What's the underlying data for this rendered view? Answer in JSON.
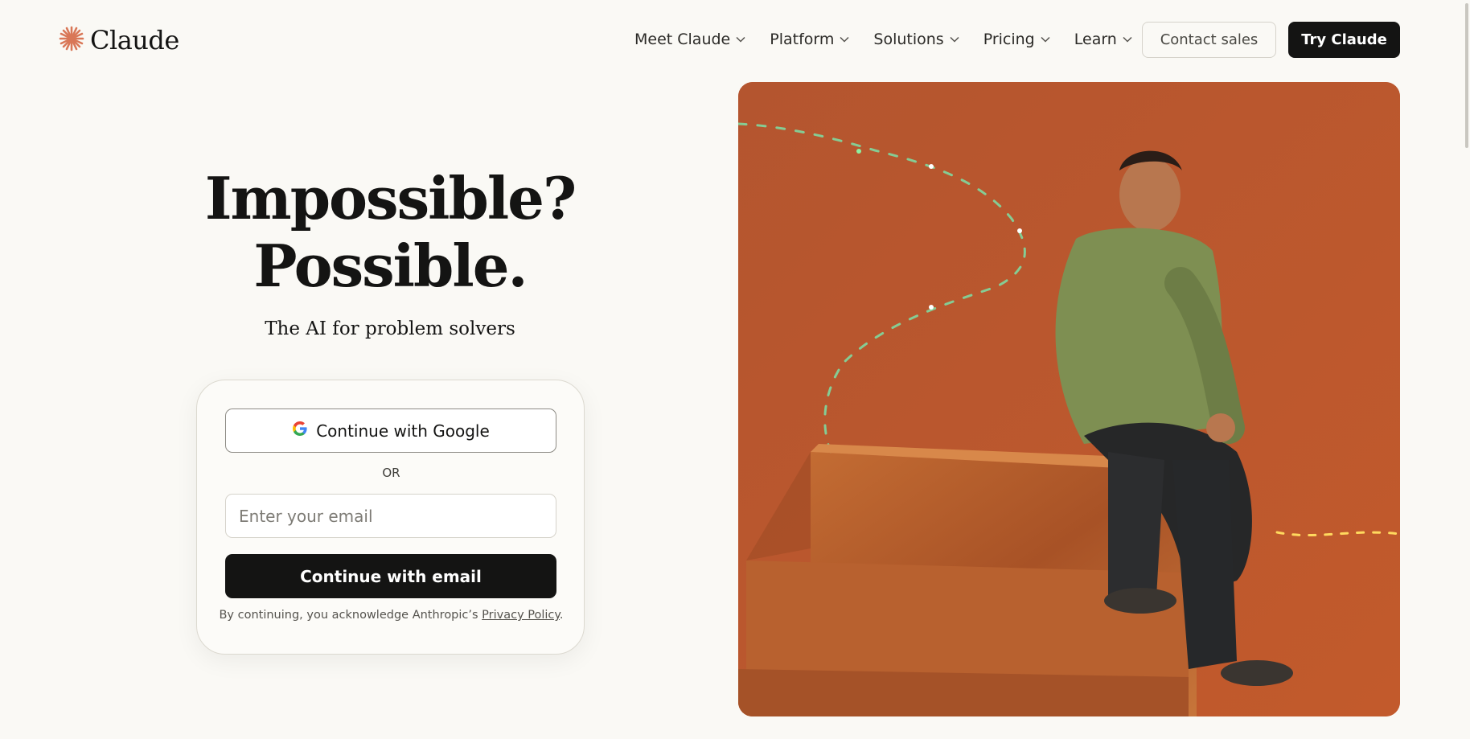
{
  "header": {
    "logo_text": "Claude",
    "nav": [
      {
        "label": "Meet Claude"
      },
      {
        "label": "Platform"
      },
      {
        "label": "Solutions"
      },
      {
        "label": "Pricing"
      },
      {
        "label": "Learn"
      }
    ],
    "contact_label": "Contact sales",
    "try_label": "Try Claude"
  },
  "hero": {
    "title_line1": "Impossible?",
    "title_line2": "Possible.",
    "subtitle": "The AI for problem solvers"
  },
  "login": {
    "google_label": "Continue with Google",
    "or_label": "OR",
    "email_placeholder": "Enter your email",
    "email_value": "",
    "email_button_label": "Continue with email",
    "legal_text": "By continuing, you acknowledge Anthropic’s ",
    "privacy_link": "Privacy Policy",
    "legal_suffix": "."
  },
  "colors": {
    "accent": "#d97757",
    "background": "#faf9f5",
    "dark": "#141413",
    "image_bg": "#b8532e"
  },
  "icons": {
    "logo": "claude-starburst-icon",
    "nav_dropdown": "chevron-down-icon",
    "google": "google-icon"
  }
}
